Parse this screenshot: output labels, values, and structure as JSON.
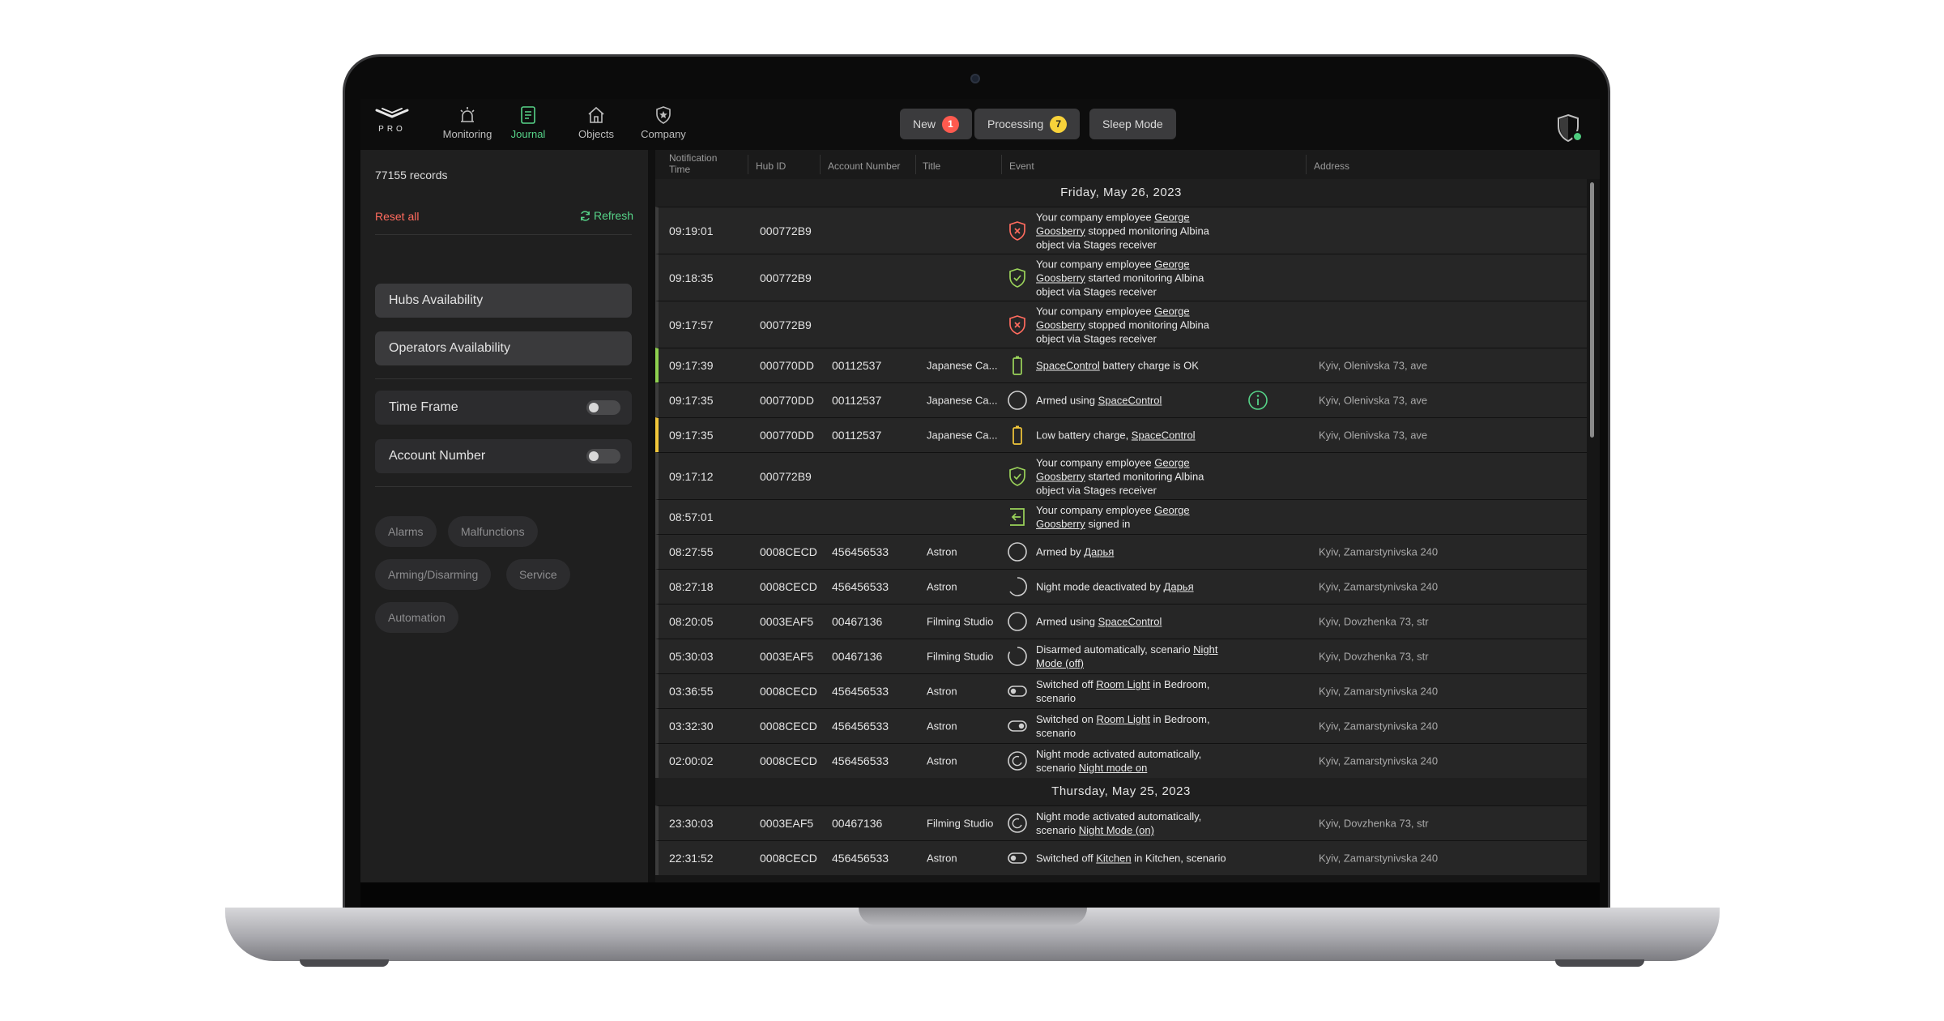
{
  "app": {
    "logo_text": "PRO",
    "nav": [
      {
        "label": "Monitoring",
        "icon": "alarm-light-icon",
        "active": false
      },
      {
        "label": "Journal",
        "icon": "journal-icon",
        "active": true
      },
      {
        "label": "Objects",
        "icon": "house-icon",
        "active": false
      },
      {
        "label": "Company",
        "icon": "company-shield-icon",
        "active": false
      }
    ],
    "status_tabs": [
      {
        "label": "New",
        "count": "1",
        "badge_color": "#ff5a4f"
      },
      {
        "label": "Processing",
        "count": "7",
        "badge_color": "#f8d23a"
      },
      {
        "label": "Sleep Mode",
        "count": null
      }
    ],
    "accent_color": "#56d388"
  },
  "sidebar": {
    "records": "77155 records",
    "reset_all": "Reset all",
    "refresh": "Refresh",
    "buttons": [
      "Hubs Availability",
      "Operators Availability"
    ],
    "toggles": [
      {
        "label": "Time Frame",
        "on": false
      },
      {
        "label": "Account Number",
        "on": false
      }
    ],
    "chips": [
      "Alarms",
      "Malfunctions",
      "Arming/Disarming",
      "Service",
      "Automation"
    ]
  },
  "journal": {
    "columns": [
      "Notification Time",
      "Hub ID",
      "Account Number",
      "Title",
      "Event",
      "Address"
    ],
    "sections": [
      {
        "date": "Friday, May 26, 2023",
        "rows": [
          {
            "time": "09:19:01",
            "hub": "000772B9",
            "account": "",
            "title": "",
            "icon": "shield-cross-icon",
            "event": [
              "Your company employee ",
              "George Goosberry",
              " stopped monitoring Albina object via Stages receiver"
            ],
            "address": "",
            "marker": "",
            "info": false,
            "tall": true
          },
          {
            "time": "09:18:35",
            "hub": "000772B9",
            "account": "",
            "title": "",
            "icon": "shield-check-icon",
            "event": [
              "Your company employee ",
              "George Goosberry",
              " started monitoring Albina object via Stages receiver"
            ],
            "address": "",
            "marker": "",
            "info": false,
            "tall": true
          },
          {
            "time": "09:17:57",
            "hub": "000772B9",
            "account": "",
            "title": "",
            "icon": "shield-cross-icon",
            "event": [
              "Your company employee ",
              "George Goosberry",
              " stopped monitoring Albina object via Stages receiver"
            ],
            "address": "",
            "marker": "",
            "info": false,
            "tall": true
          },
          {
            "time": "09:17:39",
            "hub": "000770DD",
            "account": "00112537",
            "title": "Japanese Ca...",
            "icon": "battery-full-icon",
            "event": [
              "",
              "SpaceControl",
              " battery charge is OK"
            ],
            "address": "Kyiv, Olenivska 73, ave",
            "marker": "green",
            "info": false,
            "tall": false
          },
          {
            "time": "09:17:35",
            "hub": "000770DD",
            "account": "00112537",
            "title": "Japanese Ca...",
            "icon": "armed-circle-icon",
            "event": [
              "Armed using ",
              "SpaceControl",
              ""
            ],
            "address": "Kyiv, Olenivska 73, ave",
            "marker": "",
            "info": true,
            "tall": false
          },
          {
            "time": "09:17:35",
            "hub": "000770DD",
            "account": "00112537",
            "title": "Japanese Ca...",
            "icon": "battery-low-icon",
            "event": [
              "Low battery charge, ",
              "SpaceControl",
              ""
            ],
            "address": "Kyiv, Olenivska 73, ave",
            "marker": "yellow",
            "info": false,
            "tall": false
          },
          {
            "time": "09:17:12",
            "hub": "000772B9",
            "account": "",
            "title": "",
            "icon": "shield-check-icon",
            "event": [
              "Your company employee ",
              "George Goosberry",
              " started monitoring Albina object via Stages receiver"
            ],
            "address": "",
            "marker": "",
            "info": false,
            "tall": true
          },
          {
            "time": "08:57:01",
            "hub": "",
            "account": "",
            "title": "",
            "icon": "sign-in-icon",
            "event": [
              "Your company employee ",
              "George Goosberry",
              " signed in"
            ],
            "address": "",
            "marker": "",
            "info": false,
            "tall": false
          },
          {
            "time": "08:27:55",
            "hub": "0008CECD",
            "account": "456456533",
            "title": "Astron",
            "icon": "armed-circle-icon",
            "event": [
              "Armed by ",
              "Дарья",
              ""
            ],
            "address": "Kyiv, Zamarstynivska 240",
            "marker": "",
            "info": false,
            "tall": false
          },
          {
            "time": "08:27:18",
            "hub": "0008CECD",
            "account": "456456533",
            "title": "Astron",
            "icon": "night-off-icon",
            "event": [
              "Night mode deactivated by ",
              "Дарья",
              ""
            ],
            "address": "Kyiv, Zamarstynivska 240",
            "marker": "",
            "info": false,
            "tall": false
          },
          {
            "time": "08:20:05",
            "hub": "0003EAF5",
            "account": "00467136",
            "title": "Filming Studio",
            "icon": "armed-circle-icon",
            "event": [
              "Armed using ",
              "SpaceControl",
              ""
            ],
            "address": "Kyiv, Dovzhenka 73, str",
            "marker": "",
            "info": false,
            "tall": false
          },
          {
            "time": "05:30:03",
            "hub": "0003EAF5",
            "account": "00467136",
            "title": "Filming Studio",
            "icon": "disarmed-circle-icon",
            "event": [
              "Disarmed automatically, scenario ",
              "Night Mode (off)",
              ""
            ],
            "address": "Kyiv, Dovzhenka 73, str",
            "marker": "",
            "info": false,
            "tall": false
          },
          {
            "time": "03:36:55",
            "hub": "0008CECD",
            "account": "456456533",
            "title": "Astron",
            "icon": "switch-off-icon",
            "event": [
              "Switched off ",
              "Room Light",
              " in Bedroom, scenario"
            ],
            "address": "Kyiv, Zamarstynivska 240",
            "marker": "",
            "info": false,
            "tall": false
          },
          {
            "time": "03:32:30",
            "hub": "0008CECD",
            "account": "456456533",
            "title": "Astron",
            "icon": "switch-on-icon",
            "event": [
              "Switched on ",
              "Room Light",
              " in Bedroom, scenario"
            ],
            "address": "Kyiv, Zamarstynivska 240",
            "marker": "",
            "info": false,
            "tall": false
          },
          {
            "time": "02:00:02",
            "hub": "0008CECD",
            "account": "456456533",
            "title": "Astron",
            "icon": "night-mode-icon",
            "event": [
              "Night mode activated automatically, scenario ",
              "Night mode on",
              ""
            ],
            "address": "Kyiv, Zamarstynivska 240",
            "marker": "",
            "info": false,
            "tall": false
          }
        ]
      },
      {
        "date": "Thursday, May 25, 2023",
        "rows": [
          {
            "time": "23:30:03",
            "hub": "0003EAF5",
            "account": "00467136",
            "title": "Filming Studio",
            "icon": "night-mode-icon",
            "event": [
              "Night mode activated automatically, scenario ",
              "Night Mode (on)",
              ""
            ],
            "address": "Kyiv, Dovzhenka 73, str",
            "marker": "",
            "info": false,
            "tall": false
          },
          {
            "time": "22:31:52",
            "hub": "0008CECD",
            "account": "456456533",
            "title": "Astron",
            "icon": "switch-off-icon",
            "event": [
              "Switched off ",
              "Kitchen",
              " in Kitchen, scenario"
            ],
            "address": "Kyiv, Zamarstynivska 240",
            "marker": "",
            "info": false,
            "tall": false
          }
        ]
      }
    ]
  }
}
